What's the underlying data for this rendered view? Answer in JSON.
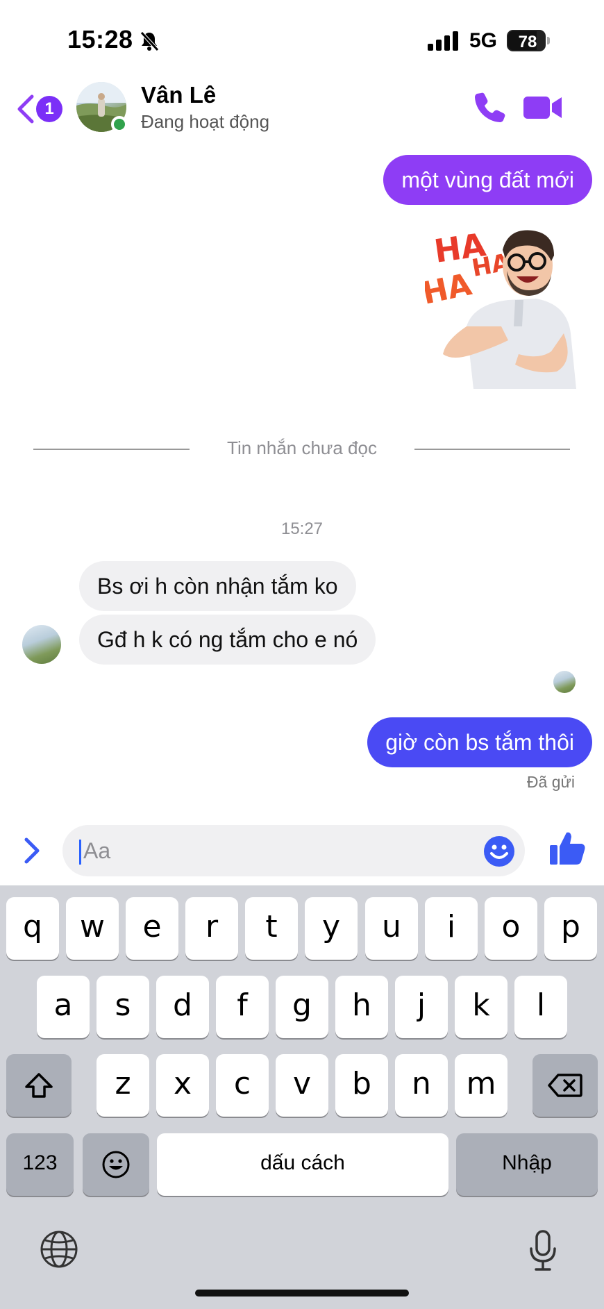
{
  "status_bar": {
    "time": "15:28",
    "network": "5G",
    "battery": "78",
    "battery_level": 0.78
  },
  "header": {
    "unread_count": "1",
    "contact_name": "Vân Lê",
    "contact_status": "Đang hoạt động",
    "accent_color": "#8e3df5"
  },
  "messages": {
    "out_1": "một vùng đất mới",
    "sticker_name": "haha-laughing-sticker",
    "unread_divider": "Tin nhắn chưa đọc",
    "timestamp": "15:27",
    "in_1": "Bs ơi h còn nhận tắm ko",
    "in_2": "Gđ h k có ng tắm cho e nó",
    "out_2": "giờ còn bs tắm thôi",
    "sent_status": "Đã gửi"
  },
  "composer": {
    "placeholder": "Aa"
  },
  "keyboard": {
    "row1": [
      "q",
      "w",
      "e",
      "r",
      "t",
      "y",
      "u",
      "i",
      "o",
      "p"
    ],
    "row2": [
      "a",
      "s",
      "d",
      "f",
      "g",
      "h",
      "j",
      "k",
      "l"
    ],
    "row3": [
      "z",
      "x",
      "c",
      "v",
      "b",
      "n",
      "m"
    ],
    "numbers": "123",
    "space": "dấu cách",
    "return": "Nhập"
  }
}
